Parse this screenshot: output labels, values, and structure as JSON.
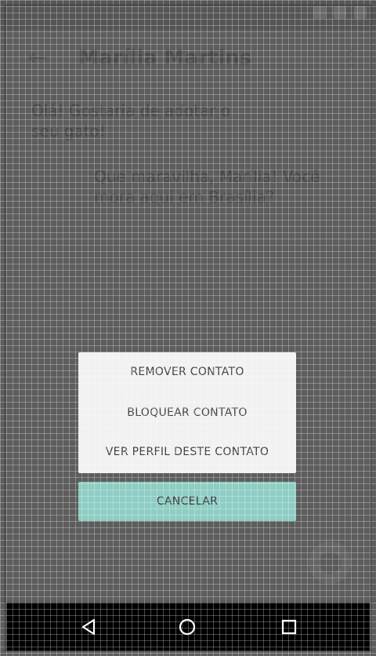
{
  "header": {
    "title": "Marília Martins"
  },
  "messages": [
    {
      "text": "Olá! Gostaria de adotar o seu gato!"
    },
    {
      "text": "Que maravilha, Marília! Você mora aqui em Brasília?"
    }
  ],
  "action_sheet": {
    "items": [
      {
        "label": "REMOVER CONTATO"
      },
      {
        "label": "BLOQUEAR CONTATO"
      },
      {
        "label": "VER PERFIL DESTE CONTATO"
      }
    ],
    "cancel_label": "CANCELAR"
  },
  "icons": {
    "back": "back-arrow-icon",
    "menu": "more-vertical-icon",
    "nav_back": "nav-back-icon",
    "nav_home": "nav-home-icon",
    "nav_recent": "nav-recent-icon"
  },
  "colors": {
    "cancel_bg": "#8ecdc3",
    "sheet_bg": "#f1f1f1",
    "scrim": "#5d5d5d"
  }
}
